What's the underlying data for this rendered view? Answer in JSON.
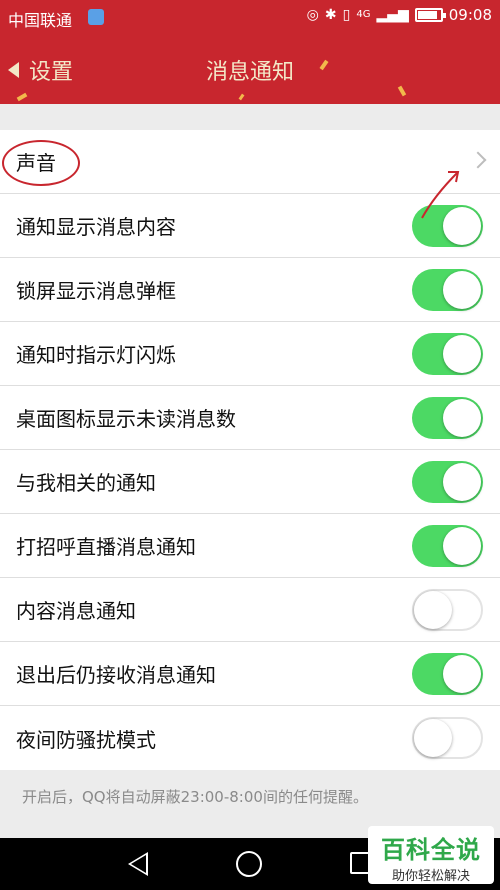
{
  "status_bar": {
    "carrier": "中国联通",
    "signal": "4G",
    "time": "09:08",
    "battery_level": 0.85
  },
  "nav": {
    "back_label": "设置",
    "title": "消息通知"
  },
  "settings": [
    {
      "label": "声音",
      "type": "link"
    },
    {
      "label": "通知显示消息内容",
      "type": "toggle",
      "on": true
    },
    {
      "label": "锁屏显示消息弹框",
      "type": "toggle",
      "on": true
    },
    {
      "label": "通知时指示灯闪烁",
      "type": "toggle",
      "on": true
    },
    {
      "label": "桌面图标显示未读消息数",
      "type": "toggle",
      "on": true
    },
    {
      "label": "与我相关的通知",
      "type": "toggle",
      "on": true
    },
    {
      "label": "打招呼直播消息通知",
      "type": "toggle",
      "on": true
    },
    {
      "label": "内容消息通知",
      "type": "toggle",
      "on": false
    },
    {
      "label": "退出后仍接收消息通知",
      "type": "toggle",
      "on": true
    },
    {
      "label": "夜间防骚扰模式",
      "type": "toggle",
      "on": false
    }
  ],
  "footnote": "开启后，QQ将自动屏蔽23:00-8:00间的任何提醒。",
  "watermark": {
    "title": "百科全说",
    "subtitle": "助你轻松解决"
  },
  "colors": {
    "header": "#c8262e",
    "toggle_on": "#4cd964",
    "annotation": "#c8262e"
  }
}
